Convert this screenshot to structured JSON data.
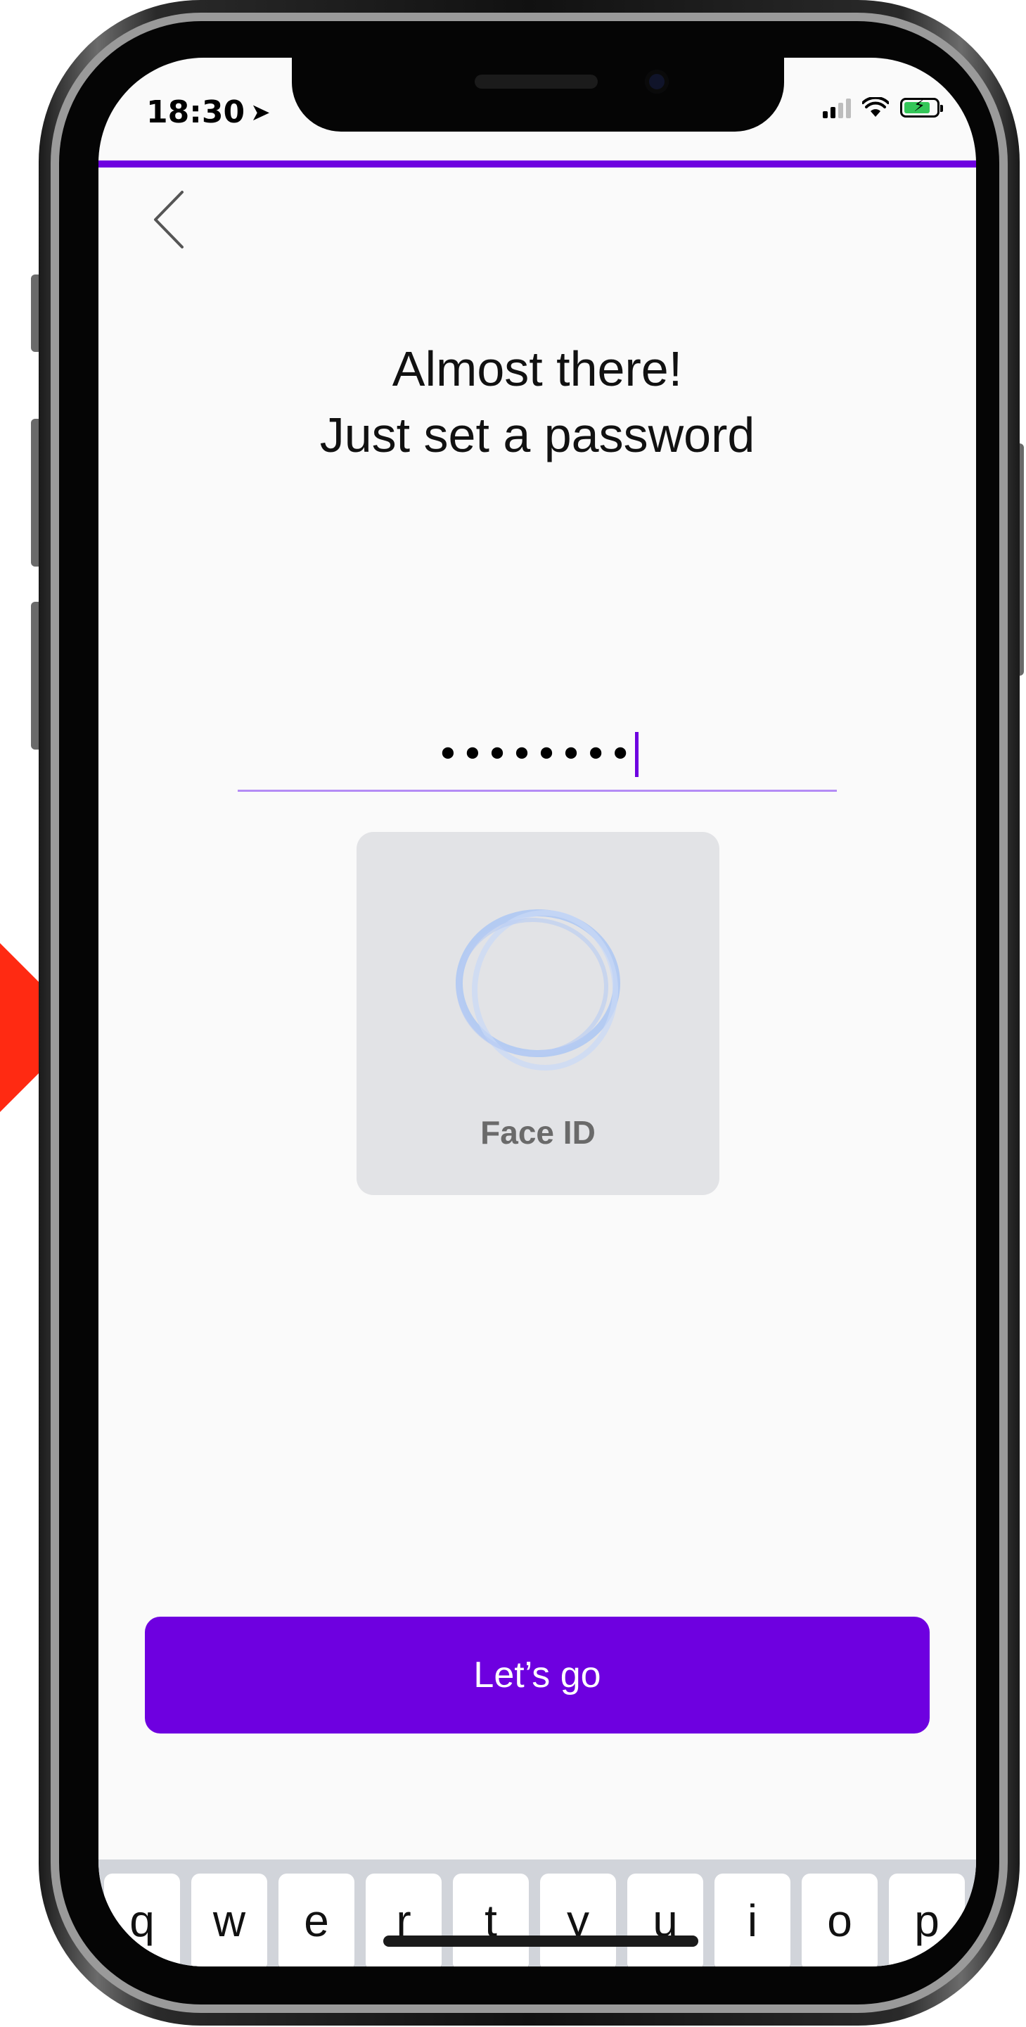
{
  "status_bar": {
    "time": "18:30",
    "location_icon": "location-arrow-icon"
  },
  "header": {
    "back_icon": "chevron-left-icon"
  },
  "content": {
    "title_line1": "Almost there!",
    "title_line2": "Just set a password",
    "password_masked": "••••••••",
    "faceid_label": "Face ID",
    "cta_label": "Let’s go"
  },
  "keyboard": {
    "keys": [
      "q",
      "w",
      "e",
      "r",
      "t",
      "y",
      "u",
      "i",
      "o",
      "p"
    ]
  },
  "colors": {
    "accent": "#6e00e0",
    "field_underline": "#b48cf5",
    "faceid_bg": "#e2e3e6",
    "pointer": "#ff2a12"
  }
}
